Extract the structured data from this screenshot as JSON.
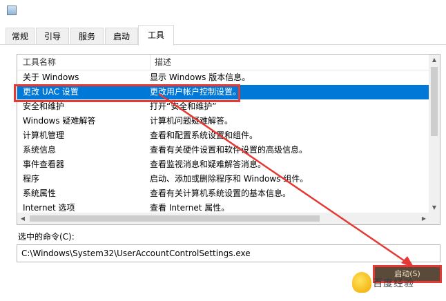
{
  "tabs": [
    {
      "label": "常规"
    },
    {
      "label": "引导"
    },
    {
      "label": "服务"
    },
    {
      "label": "启动"
    },
    {
      "label": "工具"
    }
  ],
  "list": {
    "headers": {
      "name": "工具名称",
      "desc": "描述"
    },
    "rows": [
      {
        "name": "关于 Windows",
        "desc": "显示 Windows 版本信息。"
      },
      {
        "name": "更改 UAC 设置",
        "desc": "更改用户帐户控制设置。",
        "selected": true
      },
      {
        "name": "安全和维护",
        "desc": "打开“安全和维护”"
      },
      {
        "name": "Windows 疑难解答",
        "desc": "计算机问题疑难解答。"
      },
      {
        "name": "计算机管理",
        "desc": "查看和配置系统设置和组件。"
      },
      {
        "name": "系统信息",
        "desc": "查看有关硬件设置和软件设置的高级信息。"
      },
      {
        "name": "事件查看器",
        "desc": "查看监视消息和疑难解答消息。"
      },
      {
        "name": "程序",
        "desc": "启动、添加或删除程序和 Windows 组件。"
      },
      {
        "name": "系统属性",
        "desc": "查看有关计算机系统设置的基本信息。"
      },
      {
        "name": "Internet 选项",
        "desc": "查看 Internet 属性。"
      }
    ]
  },
  "command": {
    "label": "选中的命令(C):",
    "value": "C:\\Windows\\System32\\UserAccountControlSettings.exe"
  },
  "launch_label": "启动(S)",
  "watermark_text": "百度经验",
  "colors": {
    "selection": "#0078d7",
    "annotation": "#e53935"
  }
}
